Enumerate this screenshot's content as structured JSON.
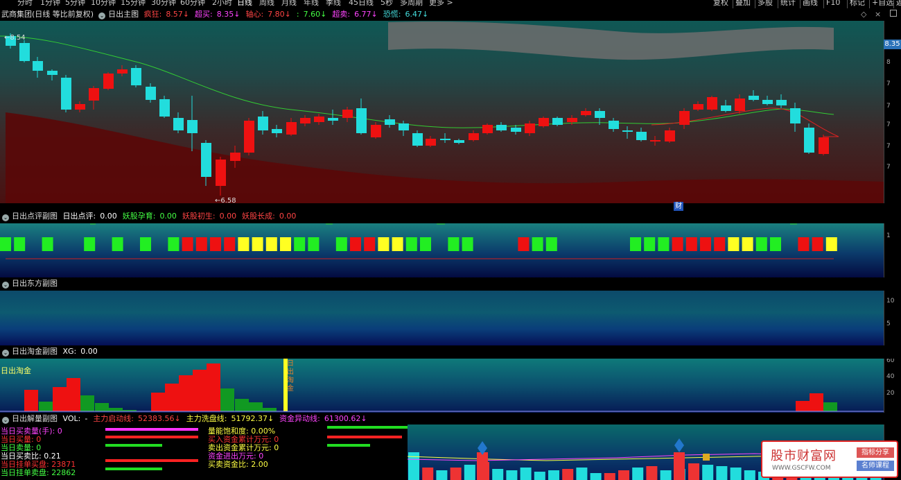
{
  "periods": [
    "分时",
    "1分钟",
    "5分钟",
    "10分钟",
    "15分钟",
    "30分钟",
    "60分钟",
    "2小时",
    "日线",
    "周线",
    "月线",
    "年线",
    "季线",
    "45日线",
    "5秒",
    "多周期",
    "更多 >"
  ],
  "active_period": "日线",
  "right_tools": [
    "复权",
    "叠加",
    "多股",
    "统计",
    "画线",
    "F10",
    "标记",
    "+自选",
    "返"
  ],
  "main": {
    "title": "武商集团(日线 等比前复权)",
    "indicator": "日出主图",
    "items": [
      {
        "label": "疯狂:",
        "value": "8.57↓",
        "color": "#ff4444"
      },
      {
        "label": "超买:",
        "value": "8.35↓",
        "color": "#ff44ff"
      },
      {
        "label": "轴心:",
        "value": "7.80↓",
        "color": "#ff4444"
      },
      {
        "label": ":",
        "value": "7.60↓",
        "color": "#44ff44"
      },
      {
        "label": "超卖:",
        "value": "6.77↓",
        "color": "#ff44ff"
      },
      {
        "label": "恐慌:",
        "value": "6.47↓",
        "color": "#44dddd"
      }
    ],
    "high_label": "8.54",
    "low_label": "6.58",
    "price_tag": "8.35",
    "cai_label": "财",
    "y_ticks": [
      "8",
      "8",
      "7",
      "7",
      "7",
      "7",
      "7"
    ]
  },
  "sub1": {
    "name": "日出点评副图",
    "items": [
      {
        "label": "日出点评:",
        "value": "0.00",
        "color": "#ffffff"
      },
      {
        "label": "妖股孕育:",
        "value": "0.00",
        "color": "#44ff44"
      },
      {
        "label": "妖股初生:",
        "value": "0.00",
        "color": "#ff4444"
      },
      {
        "label": "妖股长成:",
        "value": "0.00",
        "color": "#ff4444"
      }
    ],
    "y_tick": "1"
  },
  "sub2": {
    "name": "日出东方副图",
    "y_ticks": [
      "10",
      "5"
    ]
  },
  "sub3": {
    "name": "日出淘金副图",
    "items": [
      {
        "label": "XG:",
        "value": "0.00",
        "color": "#ffffff"
      }
    ],
    "overlay": "日出淘金",
    "vlabel": "日出淘金",
    "y_ticks": [
      "60",
      "40",
      "20"
    ]
  },
  "sub4": {
    "name": "日出解量副图",
    "items": [
      {
        "label": "VOL:",
        "value": "-",
        "color": "#ffffff"
      },
      {
        "label": "主力启动线:",
        "value": "52383.56↓",
        "color": "#ff4444"
      },
      {
        "label": "主力洗盘线:",
        "value": "51792.37↓",
        "color": "#ffff44"
      },
      {
        "label": "资金异动线:",
        "value": "61300.62↓",
        "color": "#ff44ff"
      }
    ]
  },
  "info_left": [
    {
      "text": "当日买卖量(手): 0",
      "color": "#ff44ff"
    },
    {
      "text": "当日买量: 0",
      "color": "#ff3333"
    },
    {
      "text": "当日卖量: 0",
      "color": "#44ff44"
    },
    {
      "text": "当日买卖比: 0.21",
      "color": "#ffffff"
    },
    {
      "text": "当日挂单买盘: 23871",
      "color": "#ff3333"
    },
    {
      "text": "当日挂单卖盘: 22862",
      "color": "#44ff44"
    }
  ],
  "info_mid": [
    {
      "text": "量能饱和度: 0.00%",
      "color": "#ffff44"
    },
    {
      "text": "买入资金累计万元: 0",
      "color": "#ff3333"
    },
    {
      "text": "卖出资金累计万元: 0",
      "color": "#ffff44"
    },
    {
      "text": "资金进出万元: 0",
      "color": "#ff44ff"
    },
    {
      "text": "买卖资金比: 2.00",
      "color": "#ffff44"
    }
  ],
  "watermark": {
    "name": "股市财富网",
    "url": "WWW.GSCFW.COM",
    "tag1": "指标分享",
    "tag2": "名师课程"
  }
}
